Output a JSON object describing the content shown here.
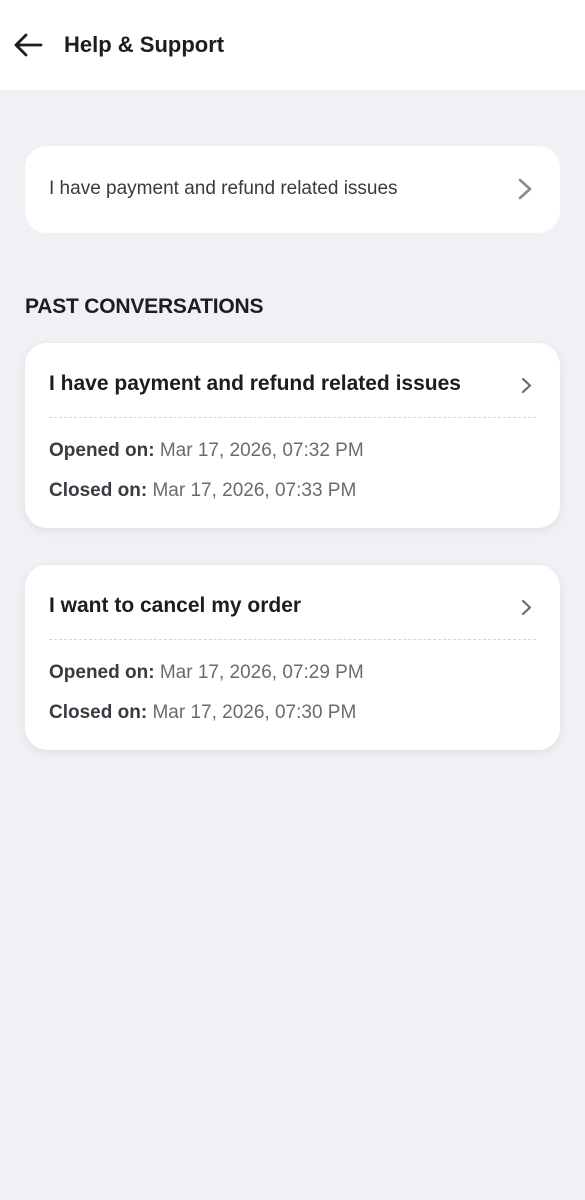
{
  "header": {
    "title": "Help & Support",
    "back_icon": "arrow-left-icon"
  },
  "issue": {
    "label": "I have payment and refund related issues",
    "chevron_icon": "chevron-right-icon"
  },
  "past_conversations": {
    "section_title": "PAST CONVERSATIONS",
    "items": [
      {
        "title": "I have payment and refund related issues",
        "opened_label": "Opened on:",
        "opened_value": "Mar 17, 2026, 07:32 PM",
        "closed_label": "Closed on:",
        "closed_value": "Mar 17, 2026, 07:33 PM"
      },
      {
        "title": "I want to cancel my order",
        "opened_label": "Opened on:",
        "opened_value": "Mar 17, 2026, 07:29 PM",
        "closed_label": "Closed on:",
        "closed_value": "Mar 17, 2026, 07:30 PM"
      }
    ]
  },
  "colors": {
    "background": "#f0f0f5",
    "card": "#ffffff",
    "text_primary": "#1c1c21",
    "text_secondary": "#6a6a72",
    "chevron": "#8a8a92"
  }
}
